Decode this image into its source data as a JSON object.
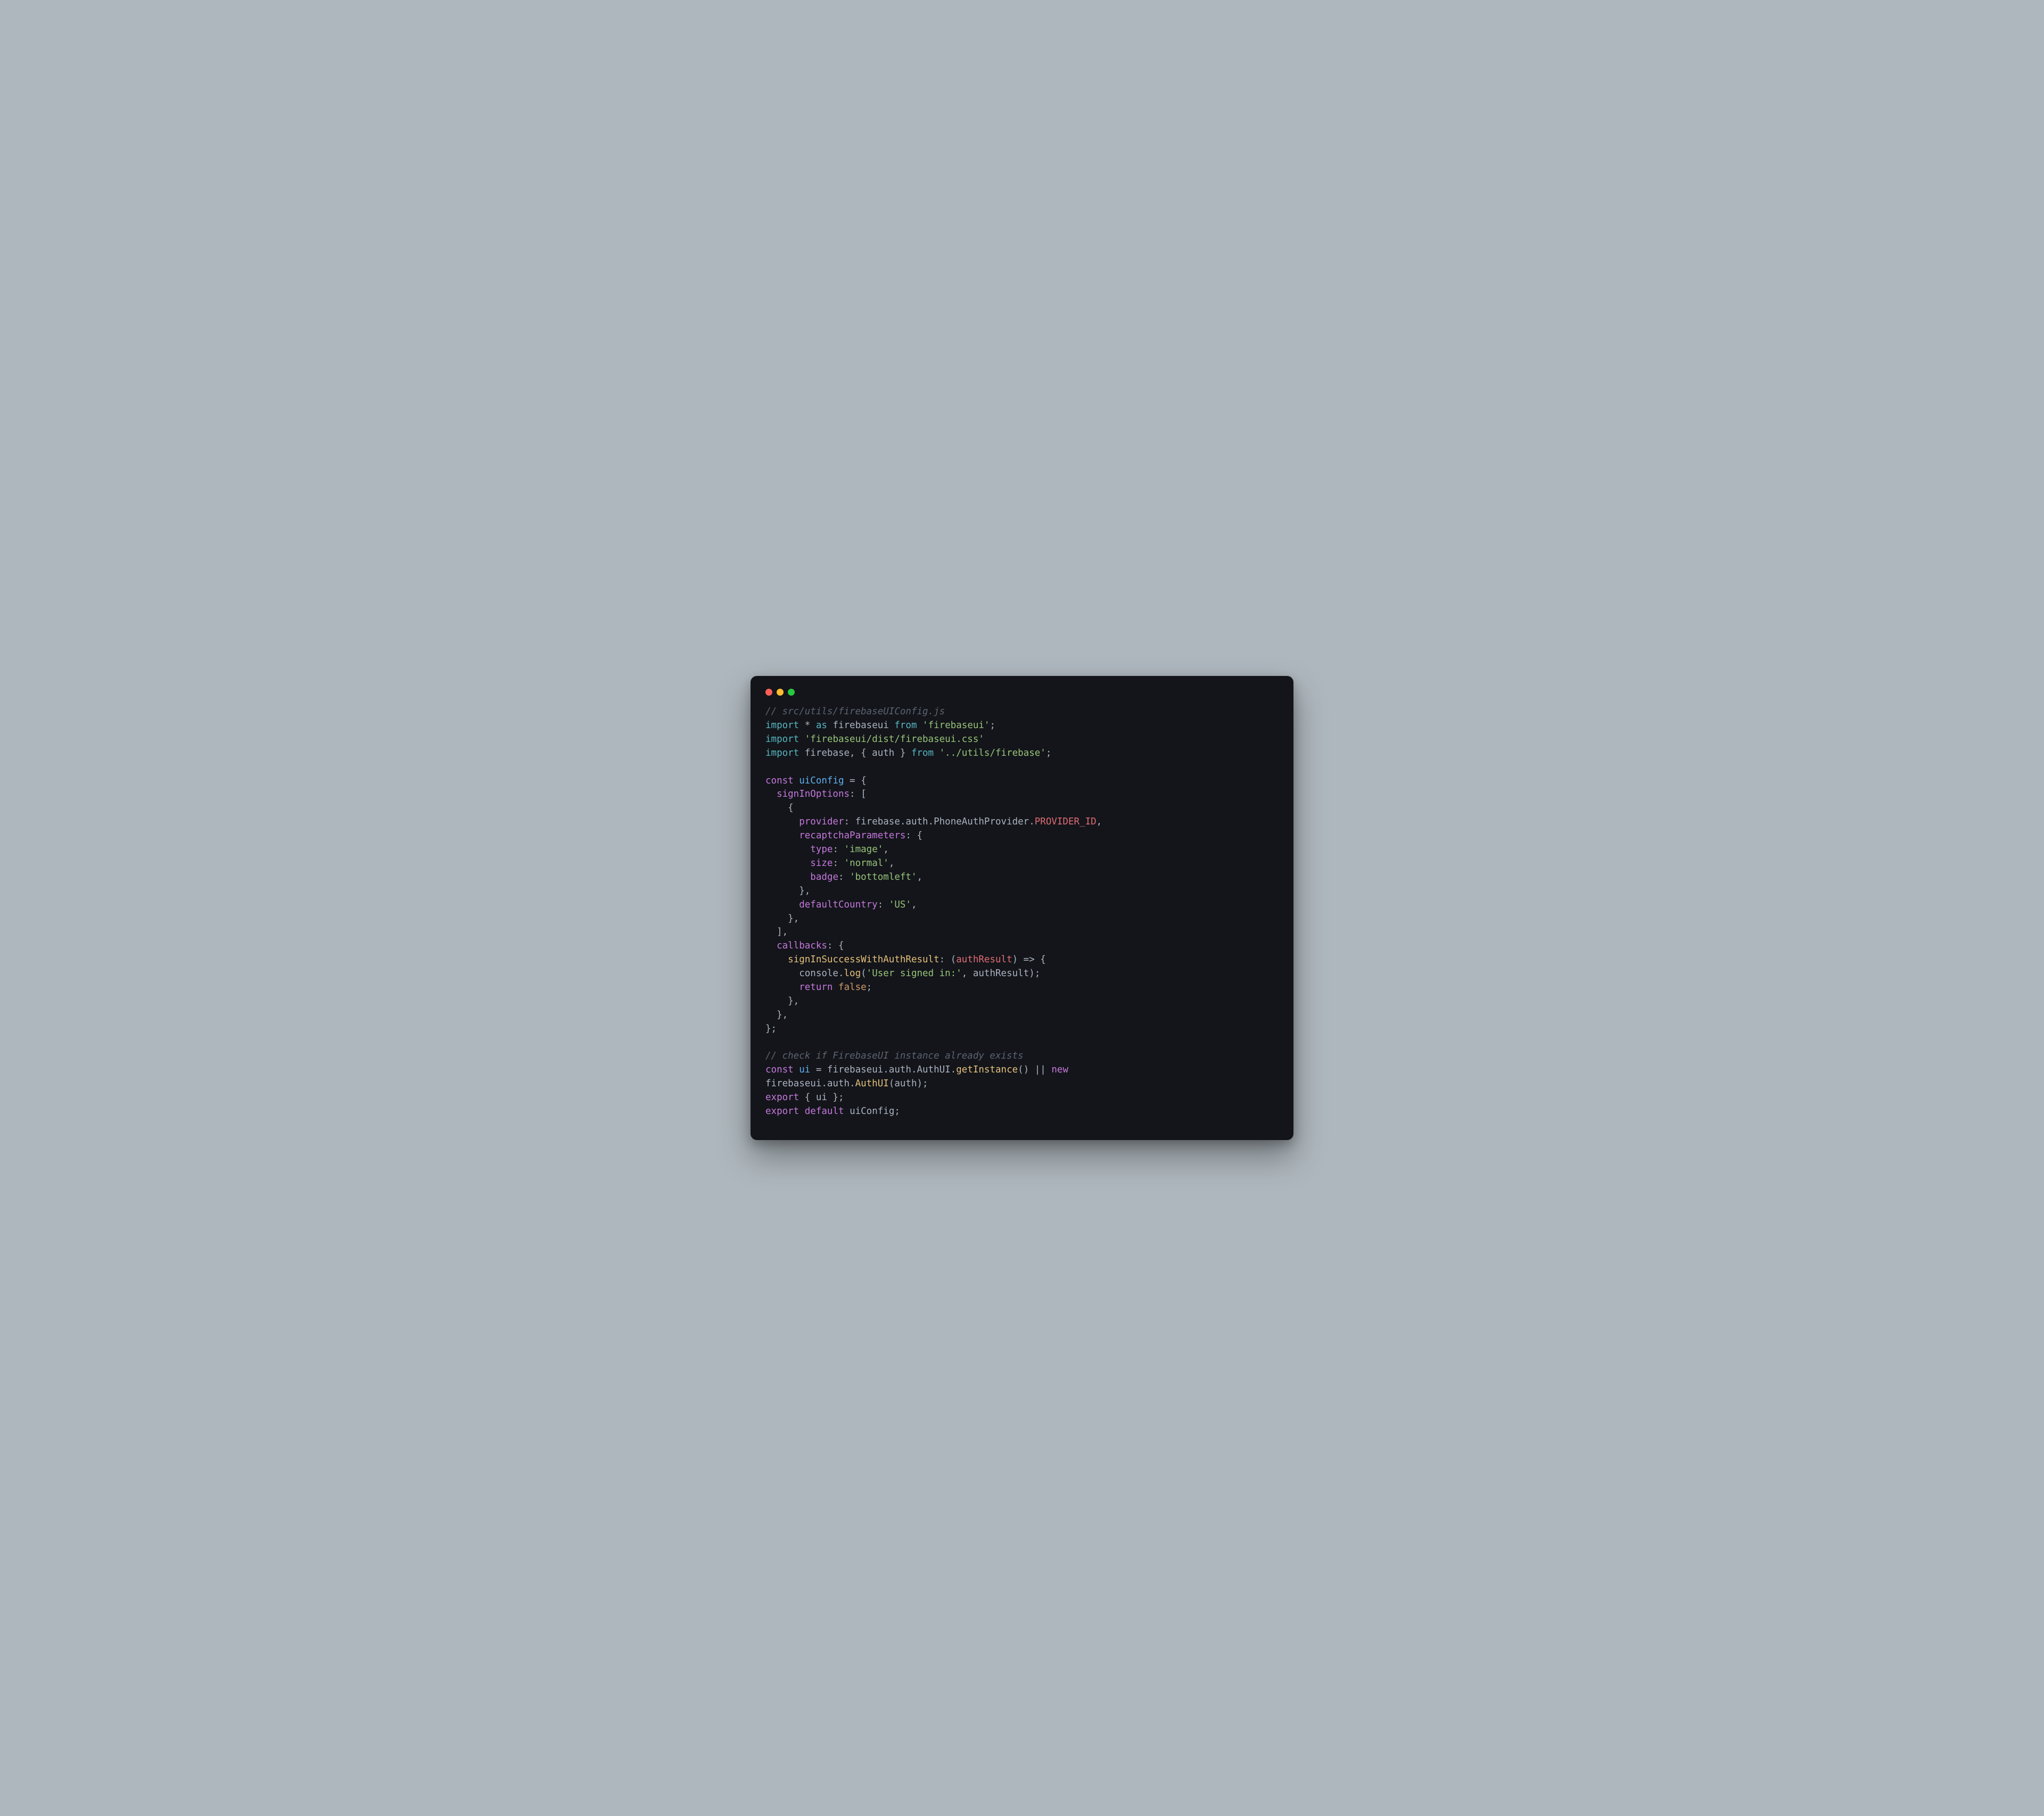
{
  "code": {
    "c1": "// src/utils/firebaseUIConfig.js",
    "l2_import": "import",
    "l2_star": " * ",
    "l2_as": "as",
    "l2_name": " firebaseui ",
    "l2_from": "from",
    "l2_str": "'firebaseui'",
    "l3_import": "import",
    "l3_str": "'firebaseui/dist/firebaseui.css'",
    "l4_import": "import",
    "l4_fb": " firebase, { auth } ",
    "l4_from": "from",
    "l4_str": "'../utils/firebase'",
    "l6_const": "const",
    "l6_name": " uiConfig ",
    "l6_eq": "= {",
    "l7_key": "signInOptions",
    "l7_rest": ": [",
    "l8": "    {",
    "l9_key": "provider",
    "l9_rest": ": firebase.auth.PhoneAuthProvider.",
    "l9_pid": "PROVIDER_ID",
    "l10_key": "recaptchaParameters",
    "l10_rest": ": {",
    "l11_key": "type",
    "l11_str": "'image'",
    "l12_key": "size",
    "l12_str": "'normal'",
    "l13_key": "badge",
    "l13_str": "'bottomleft'",
    "l14": "      },",
    "l15_key": "defaultCountry",
    "l15_str": "'US'",
    "l16": "    },",
    "l17": "  ],",
    "l18_key": "callbacks",
    "l18_rest": ": {",
    "l19_key": "signInSuccessWithAuthResult",
    "l19_rest": ": (",
    "l19_param": "authResult",
    "l19_arrow": ") => {",
    "l20_a": "      console.",
    "l20_log": "log",
    "l20_b": "(",
    "l20_str": "'User signed in:'",
    "l20_c": ", authResult);",
    "l21_ret": "return",
    "l21_false": "false",
    "l22": "    },",
    "l23": "  },",
    "l24": "};",
    "c2": "// check if FirebaseUI instance already exists",
    "l27_const": "const",
    "l27_ui": " ui ",
    "l27_a": "= firebaseui.auth.AuthUI.",
    "l27_get": "getInstance",
    "l27_b": "() || ",
    "l27_new": "new",
    "l28": "firebaseui.auth.",
    "l28_fn": "AuthUI",
    "l28_b": "(auth);",
    "l29_exp": "export",
    "l29_rest": " { ui };",
    "l30_exp": "export",
    "l30_def": "default",
    "l30_rest": " uiConfig;"
  }
}
